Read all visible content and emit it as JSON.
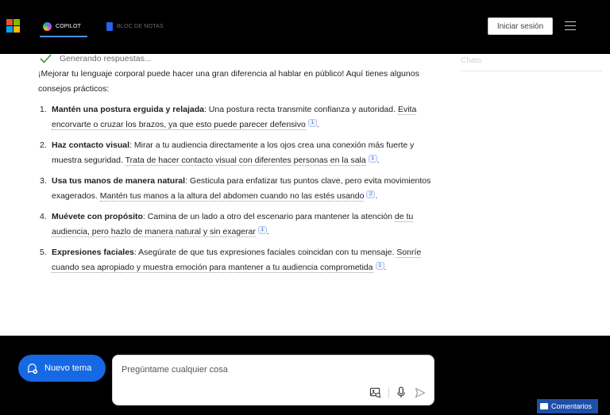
{
  "header": {
    "tabs": [
      {
        "label": "COPILOT",
        "active": true
      },
      {
        "label": "BLOC DE NOTAS",
        "active": false
      }
    ],
    "signin_label": "Iniciar sesión",
    "logo_colors": [
      "#f25022",
      "#7fba00",
      "#00a4ef",
      "#ffb900"
    ]
  },
  "side_panel": {
    "title": "Chats"
  },
  "chat": {
    "status": "Generando respuestas...",
    "intro": "¡Mejorar tu lenguaje corporal puede hacer una gran diferencia al hablar en público! Aquí tienes algunos consejos prácticos:",
    "tips": [
      {
        "number": "1.",
        "title": "Mantén una postura erguida y relajada",
        "text": ": Una postura recta transmite confianza y autoridad. ",
        "cited": "Evita encorvarte o cruzar los brazos, ya que esto puede parecer defensivo",
        "citation": "1",
        "end": "."
      },
      {
        "number": "2.",
        "title": "Haz contacto visual",
        "text": ": Mirar a tu audiencia directamente a los ojos crea una conexión más fuerte y muestra seguridad. ",
        "cited": "Trata de hacer contacto visual con diferentes personas en la sala",
        "citation": "1",
        "end": "."
      },
      {
        "number": "3.",
        "title": "Usa tus manos de manera natural",
        "text": ": Gesticula para enfatizar tus puntos clave, pero evita movimientos exagerados. ",
        "cited": "Mantén tus manos a la altura del abdomen cuando no las estés usando",
        "citation": "2",
        "end": "."
      },
      {
        "number": "4.",
        "title": "Muévete con propósito",
        "text": ": Camina de un lado a otro del escenario para mantener la atención ",
        "cited": "de tu audiencia, pero hazlo de manera natural y sin exagerar",
        "citation": "1",
        "end": "."
      },
      {
        "number": "5.",
        "title": "Expresiones faciales",
        "text": ": Asegúrate de que tus expresiones faciales coincidan con tu mensaje. ",
        "cited": "Sonríe cuando sea apropiado y muestra emoción para mantener a tu audiencia comprometida",
        "citation": "1",
        "end": "."
      }
    ]
  },
  "composer": {
    "new_topic_label": "Nuevo tema",
    "placeholder": "Pregúntame cualquier cosa"
  },
  "feedback_label": "Comentarios",
  "colors": {
    "accent": "#1668e3",
    "header_bg": "#000000",
    "feedback_bg": "#1f4fa8"
  }
}
